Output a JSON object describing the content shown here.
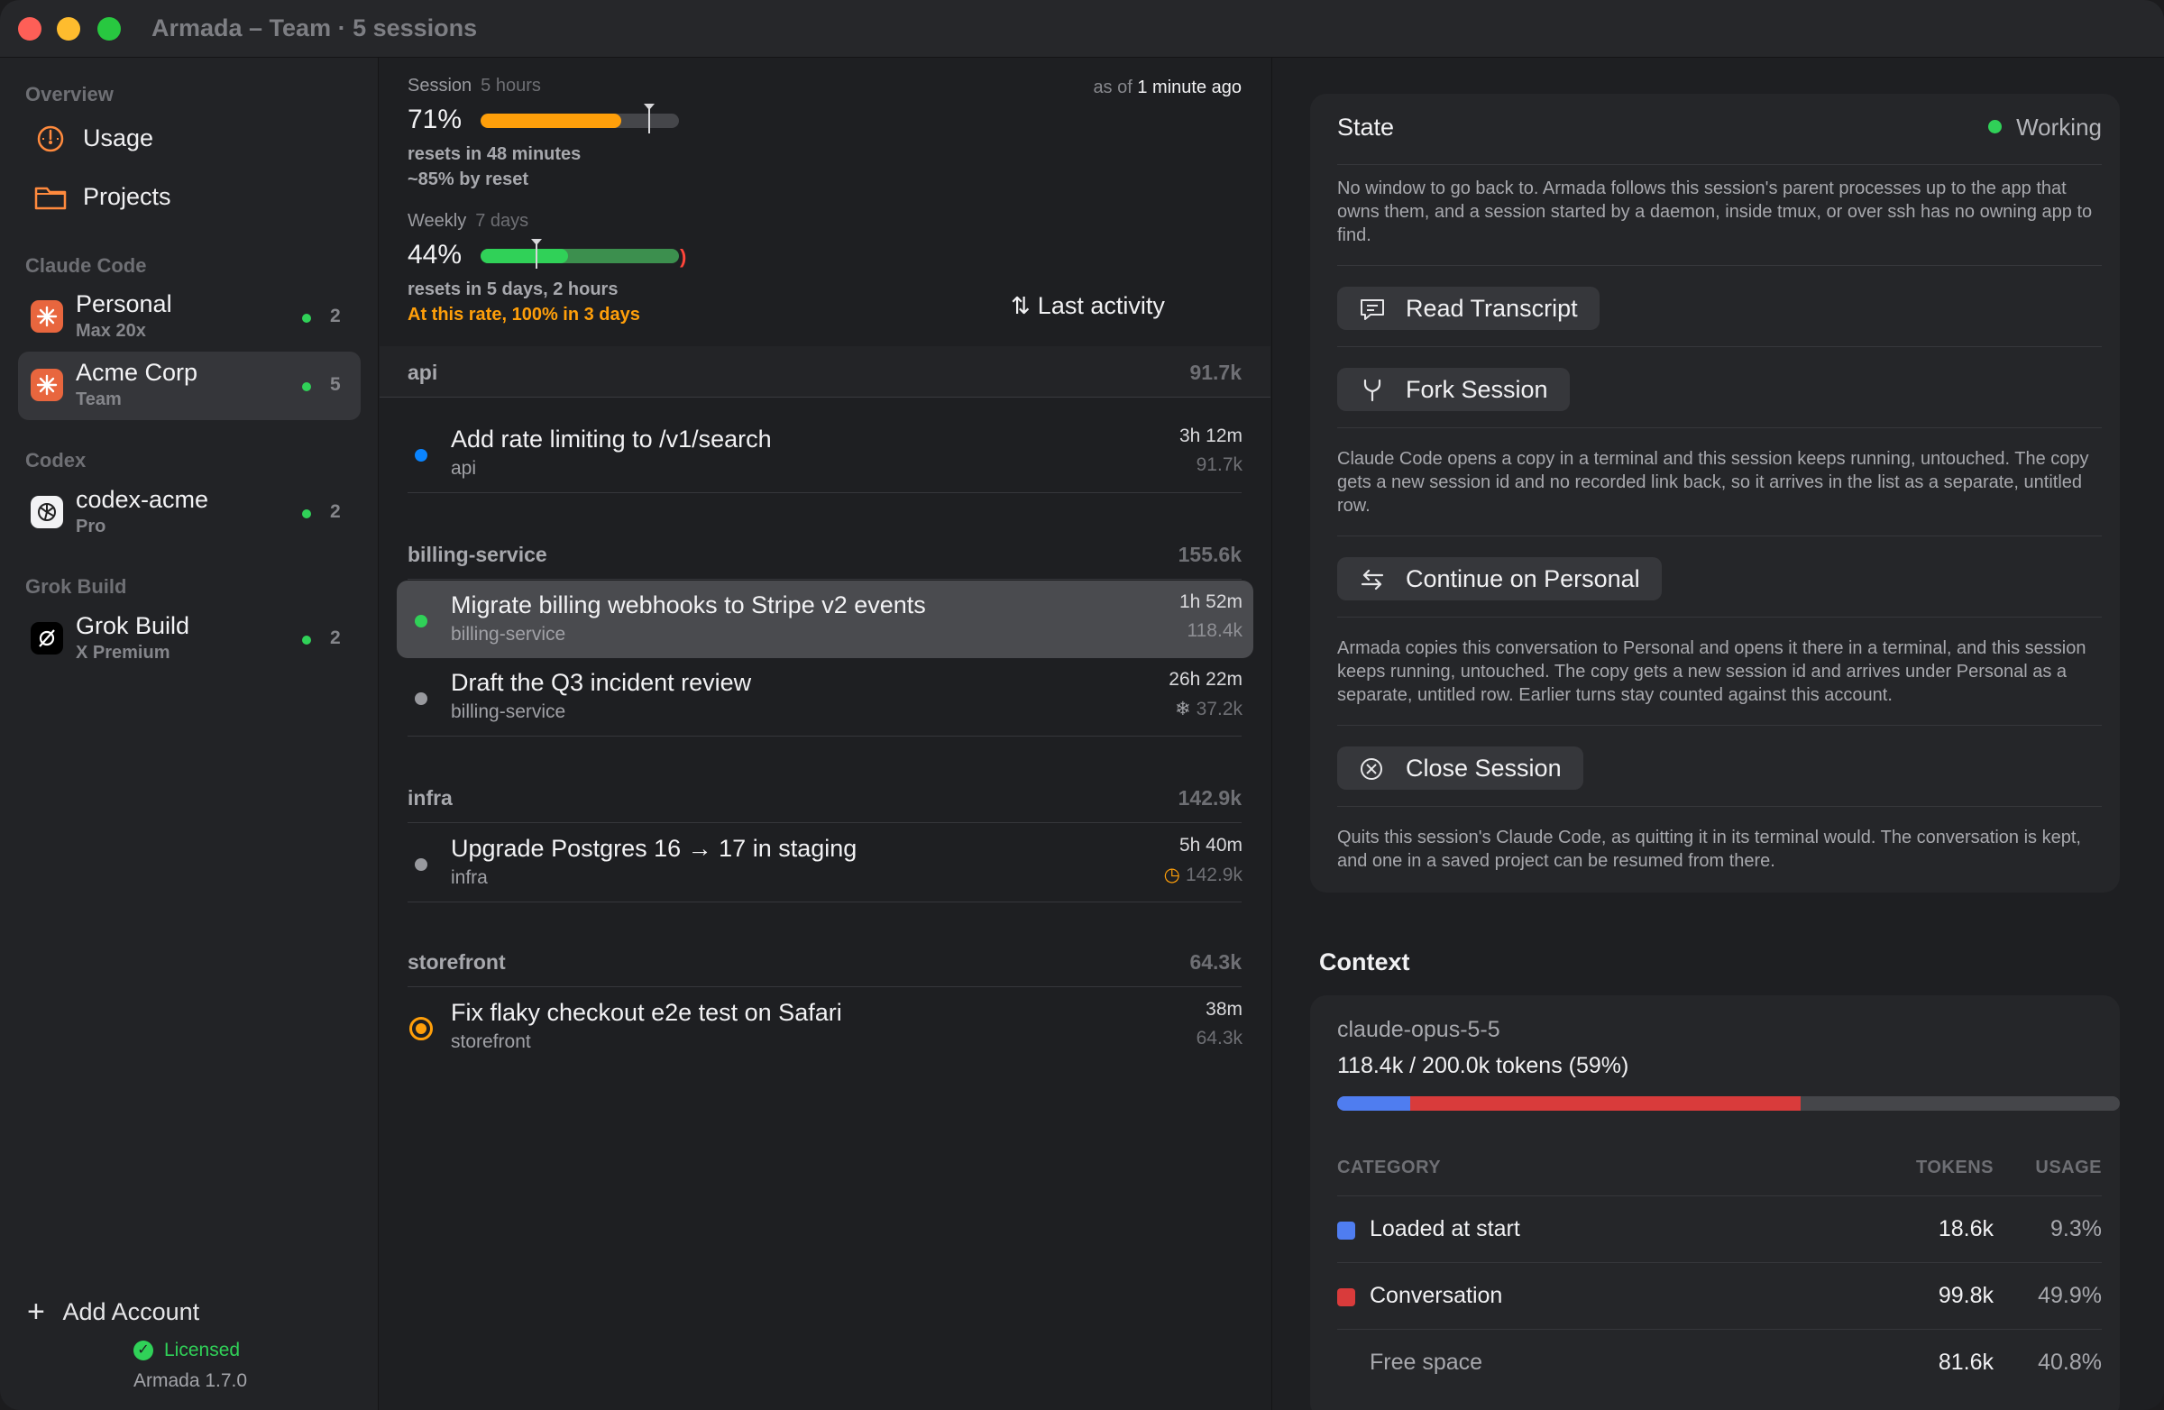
{
  "window": {
    "title": "Armada – Team · 5 sessions"
  },
  "sidebar": {
    "overview_header": "Overview",
    "nav": [
      {
        "label": "Usage",
        "icon": "gauge-icon"
      },
      {
        "label": "Projects",
        "icon": "folder-icon"
      }
    ],
    "sections": [
      {
        "header": "Claude Code",
        "accounts": [
          {
            "name": "Personal",
            "plan": "Max 20x",
            "count": "2",
            "icon": "claude-icon",
            "selected": false
          },
          {
            "name": "Acme Corp",
            "plan": "Team",
            "count": "5",
            "icon": "claude-icon",
            "selected": true
          }
        ]
      },
      {
        "header": "Codex",
        "accounts": [
          {
            "name": "codex-acme",
            "plan": "Pro",
            "count": "2",
            "icon": "openai-icon",
            "selected": false
          }
        ]
      },
      {
        "header": "Grok Build",
        "accounts": [
          {
            "name": "Grok Build",
            "plan": "X Premium",
            "count": "2",
            "icon": "grok-icon",
            "selected": false
          }
        ]
      }
    ],
    "add_account": "Add Account",
    "license_status": "Licensed",
    "version": "Armada 1.7.0"
  },
  "usage": {
    "as_of_prefix": "as of",
    "as_of_value": "1 minute ago",
    "session": {
      "label": "Session",
      "window": "5 hours",
      "percent_text": "71%",
      "percent": 0.71,
      "marker": 0.85,
      "resets": "resets in 48 minutes",
      "projection": "~85% by reset"
    },
    "weekly": {
      "label": "Weekly",
      "window": "7 days",
      "percent_text": "44%",
      "percent": 0.44,
      "marker": 0.28,
      "resets": "resets in 5 days, 2 hours",
      "warning": "At this rate, 100% in 3 days"
    },
    "sort_label": "Last activity"
  },
  "groups": [
    {
      "name": "api",
      "total": "91.7k",
      "sessions": [
        {
          "title": "Add rate limiting to /v1/search",
          "project": "api",
          "time": "3h 12m",
          "tokens": "91.7k",
          "status": "blue",
          "selected": false,
          "badge": ""
        }
      ]
    },
    {
      "name": "billing-service",
      "total": "155.6k",
      "sessions": [
        {
          "title": "Migrate billing webhooks to Stripe v2 events",
          "project": "billing-service",
          "time": "1h 52m",
          "tokens": "118.4k",
          "status": "green",
          "selected": true,
          "badge": ""
        },
        {
          "title": "Draft the Q3 incident review",
          "project": "billing-service",
          "time": "26h 22m",
          "tokens": "37.2k",
          "status": "gray",
          "selected": false,
          "badge": "❄"
        }
      ]
    },
    {
      "name": "infra",
      "total": "142.9k",
      "sessions": [
        {
          "title": "Upgrade Postgres 16 → 17 in staging",
          "project": "infra",
          "time": "5h 40m",
          "tokens": "142.9k",
          "status": "gray",
          "selected": false,
          "badge": "◷"
        }
      ]
    },
    {
      "name": "storefront",
      "total": "64.3k",
      "sessions": [
        {
          "title": "Fix flaky checkout e2e test on Safari",
          "project": "storefront",
          "time": "38m",
          "tokens": "64.3k",
          "status": "orange-ring",
          "selected": false,
          "badge": ""
        }
      ]
    }
  ],
  "detail": {
    "state_title": "State",
    "state_value": "Working",
    "state_note": "No window to go back to. Armada follows this session's parent processes up to the app that owns them, and a session started by a daemon, inside tmux, or over ssh has no owning app to find.",
    "read_transcript": "Read Transcript",
    "fork_session": "Fork Session",
    "fork_note": "Claude Code opens a copy in a terminal and this session keeps running, untouched. The copy gets a new session id and no recorded link back, so it arrives in the list as a separate, untitled row.",
    "continue_label": "Continue on Personal",
    "continue_note": "Armada copies this conversation to Personal and opens it there in a terminal, and this session keeps running, untouched. The copy gets a new session id and arrives under Personal as a separate, untitled row. Earlier turns stay counted against this account.",
    "close_session": "Close Session",
    "close_note": "Quits this session's Claude Code, as quitting it in its terminal would. The conversation is kept, and one in a saved project can be resumed from there."
  },
  "context": {
    "title": "Context",
    "model": "claude-opus-5-5",
    "tokens_line": "118.4k / 200.0k tokens (59%)",
    "headers": {
      "category": "CATEGORY",
      "tokens": "TOKENS",
      "usage": "USAGE"
    },
    "rows": [
      {
        "category": "Loaded at start",
        "tokens": "18.6k",
        "usage": "9.3%",
        "fraction": 0.093,
        "color": "#4f7df0"
      },
      {
        "category": "Conversation",
        "tokens": "99.8k",
        "usage": "49.9%",
        "fraction": 0.499,
        "color": "#d93b3b"
      },
      {
        "category": "Free space",
        "tokens": "81.6k",
        "usage": "40.8%",
        "fraction": 0.408,
        "color": ""
      }
    ]
  },
  "colors": {
    "accent_orange": "#ff9f0a",
    "green": "#30d158",
    "blue": "#0a84ff",
    "red": "#ff453a"
  }
}
